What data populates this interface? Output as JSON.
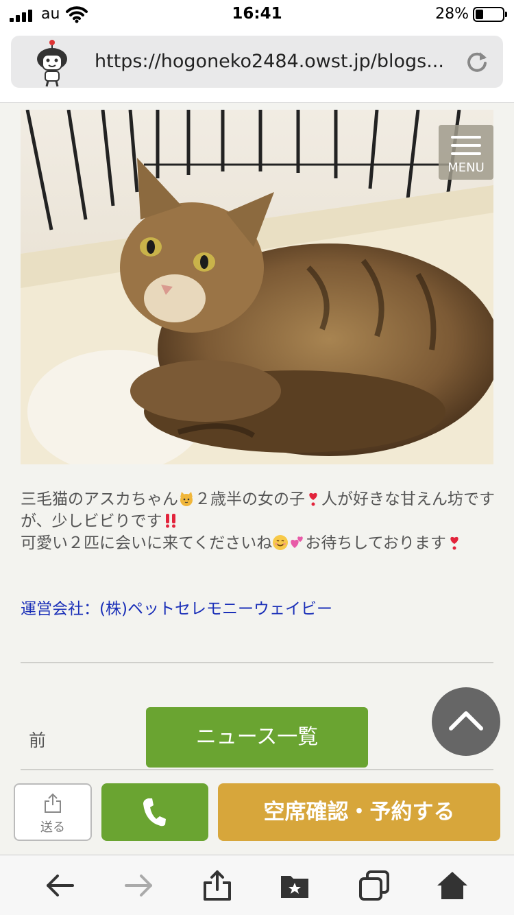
{
  "status_bar": {
    "carrier": "au",
    "time": "16:41",
    "battery_percent": "28%",
    "battery_level": 0.28
  },
  "browser": {
    "url": "https://hogoneko2484.owst.jp/blogs..."
  },
  "header": {
    "menu_label": "MENU"
  },
  "post": {
    "line1_a": "三毛猫のアスカちゃん",
    "line1_b": "２歳半の女の子",
    "line1_c": "人が好きな甘えん坊ですが、少しビビりです",
    "line2_a": "可愛い２匹に会いに来てくださいね",
    "line2_b": "お待ちしております",
    "company": "運営会社：(株)ペットセレモニーウェイビー"
  },
  "pager": {
    "prev_label": "前",
    "news_list_label": "ニュース一覧"
  },
  "actions": {
    "send_label": "送る",
    "reserve_label": "空席確認・予約する"
  },
  "colors": {
    "green": "#6aa431",
    "gold": "#d7a63b",
    "link": "#1a2fb8"
  }
}
